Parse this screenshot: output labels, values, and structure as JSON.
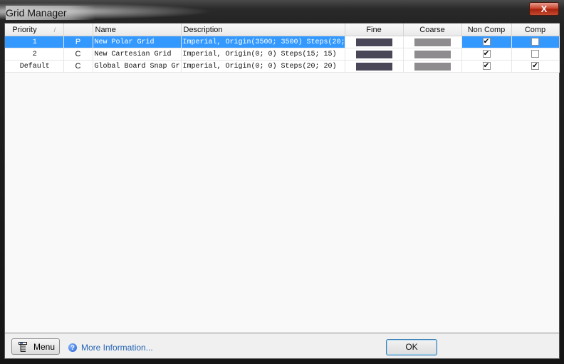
{
  "window": {
    "title": "Grid Manager",
    "close_label": "X"
  },
  "table": {
    "columns": [
      "Priority",
      "",
      "Name",
      "Description",
      "Fine",
      "Coarse",
      "Non Comp",
      "Comp"
    ],
    "sort_indicator": "/",
    "rows": [
      {
        "priority": "1",
        "type": "P",
        "name": "New Polar Grid",
        "description": "Imperial, Origin(3500; 3500) Steps(20;",
        "fine_color": "#4a4858",
        "coarse_color": "#8e8c8e",
        "non_comp": true,
        "comp": false,
        "selected": true
      },
      {
        "priority": "2",
        "type": "C",
        "name": "New Cartesian Grid",
        "description": "Imperial, Origin(0; 0) Steps(15; 15)",
        "fine_color": "#4a4858",
        "coarse_color": "#8e8c8e",
        "non_comp": true,
        "comp": false,
        "selected": false
      },
      {
        "priority": "Default",
        "type": "C",
        "name": "Global Board Snap Gr",
        "description": "Imperial, Origin(0; 0) Steps(20; 20)",
        "fine_color": "#4a4858",
        "coarse_color": "#8e8c8e",
        "non_comp": true,
        "comp": true,
        "selected": false
      }
    ]
  },
  "footer": {
    "menu_label": "Menu",
    "more_info_label": "More Information...",
    "help_icon": "?",
    "ok_label": "OK"
  },
  "colors": {
    "selection": "#3399ff",
    "link": "#2464b4"
  }
}
